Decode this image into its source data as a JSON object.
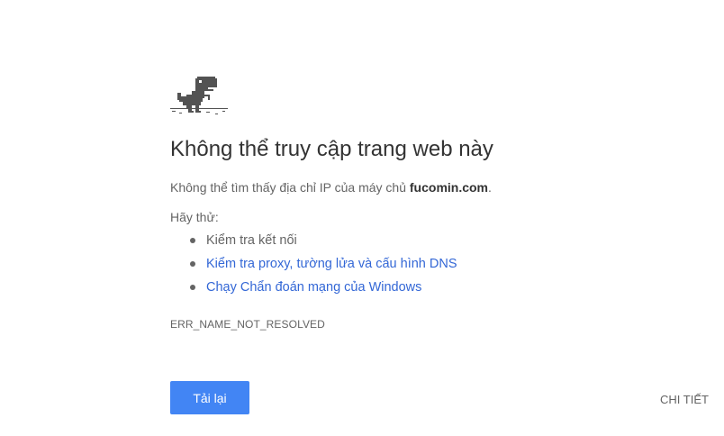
{
  "error_page": {
    "title": "Không thể truy cập trang web này",
    "description_prefix": "Không thể tìm thấy địa chỉ IP của máy chủ ",
    "host": "fucomin.com",
    "description_suffix": ".",
    "try_label": "Hãy thử:",
    "suggestions": [
      {
        "label": "Kiểm tra kết nối",
        "is_link": false
      },
      {
        "label": "Kiểm tra proxy, tường lửa và cấu hình DNS",
        "is_link": true
      },
      {
        "label": "Chạy Chẩn đoán mạng của Windows",
        "is_link": true
      }
    ],
    "error_code": "ERR_NAME_NOT_RESOLVED",
    "reload_label": "Tải lại",
    "details_label": "CHI TIẾT",
    "icon": "offline-dinosaur-icon"
  },
  "colors": {
    "title": "#333333",
    "body_text": "#646464",
    "link": "#3367d6",
    "button_bg": "#4285f4",
    "button_text": "#ffffff",
    "dino": "#535353"
  }
}
